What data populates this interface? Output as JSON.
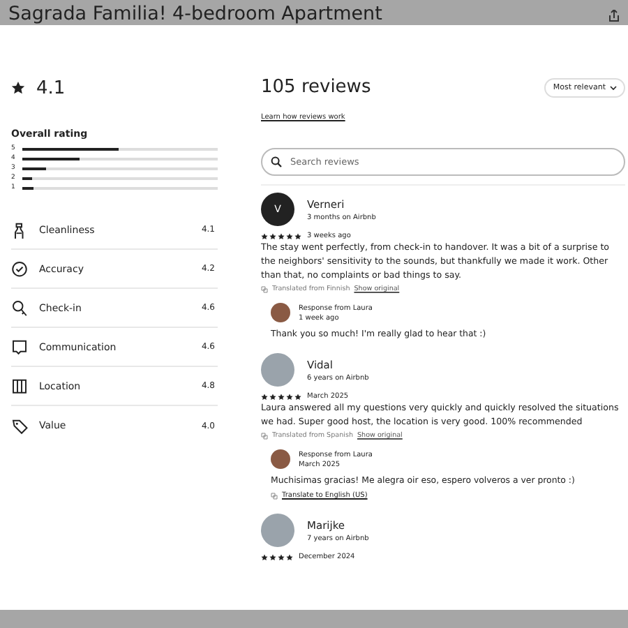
{
  "page_title": "Sagrada Familia! 4-bedroom Apartment",
  "rating": {
    "value": "4.1",
    "overall_label": "Overall rating",
    "distribution": [
      {
        "label": "5",
        "level": 0.49
      },
      {
        "label": "4",
        "level": 0.29
      },
      {
        "label": "3",
        "level": 0.12
      },
      {
        "label": "2",
        "level": 0.05
      },
      {
        "label": "1",
        "level": 0.06
      }
    ],
    "categories": [
      {
        "kind": "cleanliness",
        "label": "Cleanliness",
        "score": "4.1"
      },
      {
        "kind": "accuracy",
        "label": "Accuracy",
        "score": "4.2"
      },
      {
        "kind": "checkin",
        "label": "Check-in",
        "score": "4.6"
      },
      {
        "kind": "communication",
        "label": "Communication",
        "score": "4.6"
      },
      {
        "kind": "location",
        "label": "Location",
        "score": "4.8"
      },
      {
        "kind": "value",
        "label": "Value",
        "score": "4.0"
      }
    ]
  },
  "reviews_header": {
    "title": "105 reviews",
    "link": "Learn how reviews work",
    "sort": "Most relevant"
  },
  "search": {
    "placeholder": "Search reviews"
  },
  "reviews": [
    {
      "kind": "letter",
      "initial": "V",
      "name": "Verneri",
      "tenure": "3 months on Airbnb",
      "stars": 5,
      "date": "3 weeks ago",
      "text": "The stay went perfectly, from check-in to handover. It was a bit of a surprise to the neighbors' sensitivity to the sounds, but thankfully we made it work. Other than that, no complaints or bad things to say.",
      "translated_from": "Translated from Finnish",
      "show_original": "Show original",
      "response": {
        "title": "Response from Laura",
        "date": "1 week ago",
        "text": "Thank you so much! I'm really glad to hear that :)"
      }
    },
    {
      "kind": "photo",
      "name": "Vidal",
      "tenure": "6 years on Airbnb",
      "stars": 5,
      "date": "March 2025",
      "text": "Laura answered all my questions very quickly and quickly resolved the situations we had. Super good host, the location is very good. 100% recommended",
      "translated_from": "Translated from Spanish",
      "show_original": "Show original",
      "response": {
        "title": "Response from Laura",
        "date": "March 2025",
        "text": "Muchisimas gracias! Me alegra oir eso, espero volveros a ver pronto :)",
        "translate_link": "Translate to English (US)"
      }
    },
    {
      "kind": "photo",
      "name": "Marijke",
      "tenure": "7 years on Airbnb",
      "stars": 4,
      "date": "December 2024"
    }
  ]
}
